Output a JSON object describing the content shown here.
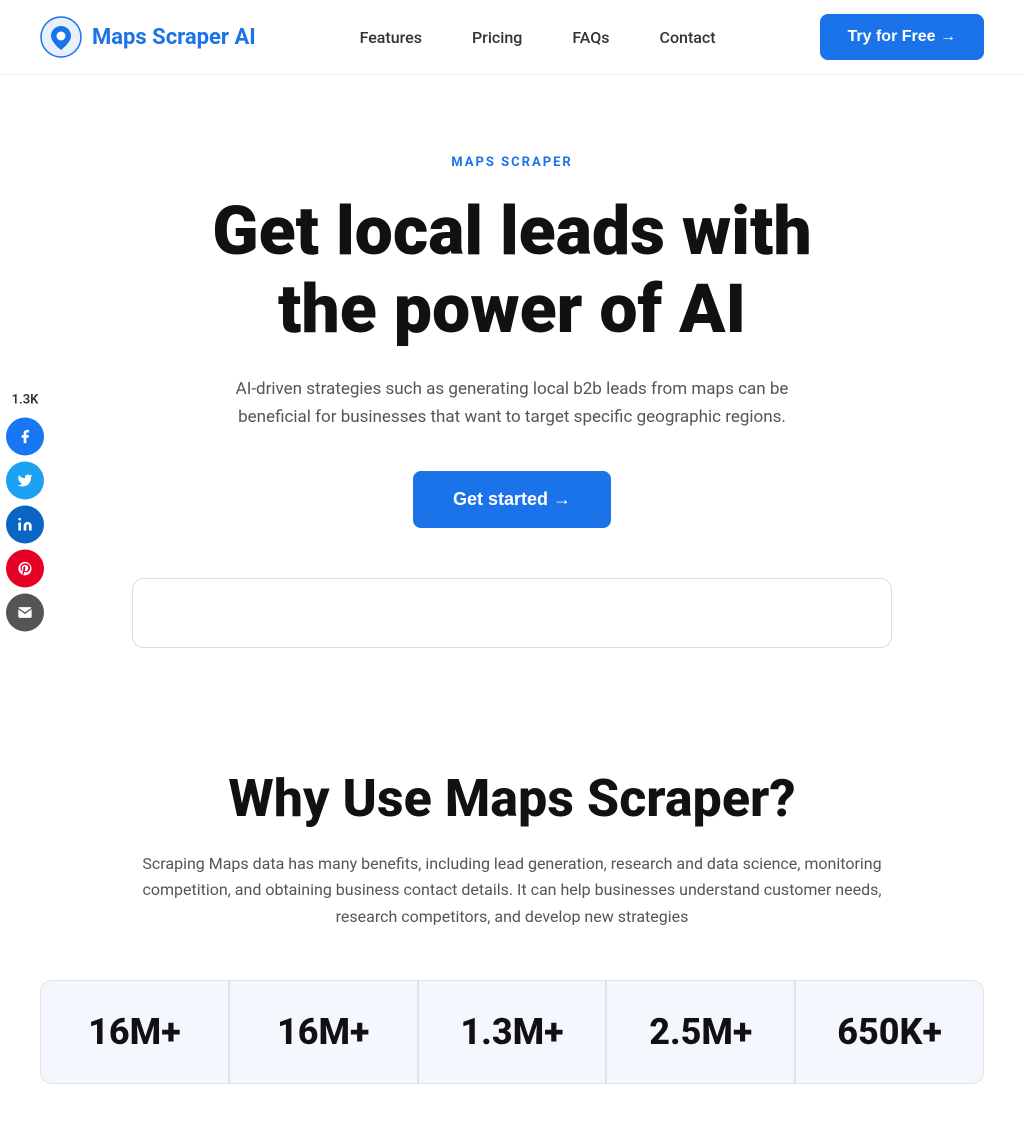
{
  "nav": {
    "logo_text": "Maps Scraper AI",
    "links": [
      {
        "label": "Features",
        "href": "#"
      },
      {
        "label": "Pricing",
        "href": "#"
      },
      {
        "label": "FAQs",
        "href": "#"
      },
      {
        "label": "Contact",
        "href": "#"
      }
    ],
    "cta_label": "Try for Free →"
  },
  "social": {
    "count": "1.3K",
    "buttons": [
      {
        "name": "facebook",
        "icon": "f",
        "class": "social-fb"
      },
      {
        "name": "twitter",
        "icon": "t",
        "class": "social-tw"
      },
      {
        "name": "linkedin",
        "icon": "in",
        "class": "social-li"
      },
      {
        "name": "pinterest",
        "icon": "p",
        "class": "social-pi"
      },
      {
        "name": "email",
        "icon": "✉",
        "class": "social-em"
      }
    ]
  },
  "hero": {
    "label": "MAPS SCRAPER",
    "title_line1": "Get local leads with",
    "title_line2": "the power of AI",
    "subtitle": "AI-driven strategies such as generating local b2b leads from maps can be beneficial for businesses that want to target specific geographic regions.",
    "cta_label": "Get started →"
  },
  "why": {
    "title": "Why Use Maps Scraper?",
    "subtitle": "Scraping Maps data has many benefits, including lead generation, research and data science, monitoring competition, and obtaining business contact details. It can help businesses understand customer needs, research competitors, and develop new strategies"
  },
  "stats": [
    {
      "value": "16M+"
    },
    {
      "value": "16M+"
    },
    {
      "value": "1.3M+"
    },
    {
      "value": "2.5M+"
    },
    {
      "value": "650K+"
    }
  ]
}
